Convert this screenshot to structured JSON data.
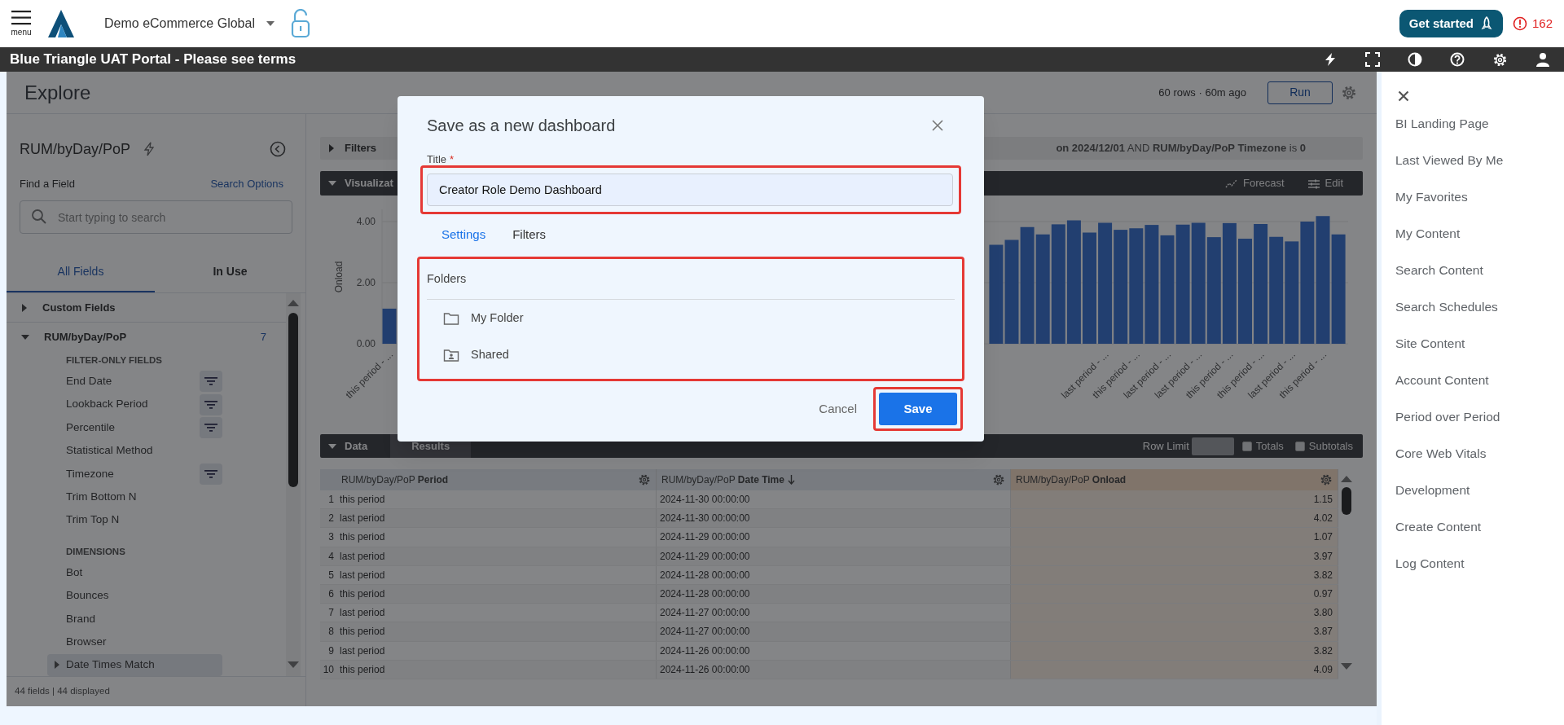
{
  "header": {
    "menu_label": "menu",
    "workspace": "Demo eCommerce Global",
    "get_started": "Get started",
    "alert_count": "162"
  },
  "banner": {
    "title": "Blue Triangle UAT Portal - Please see terms"
  },
  "explore": {
    "title": "Explore",
    "run_info": "60 rows · 60m ago",
    "run_button": "Run"
  },
  "field_panel": {
    "title": "RUM/byDay/PoP",
    "find_label": "Find a Field",
    "search_options": "Search Options",
    "search_placeholder": "Start typing to search",
    "tabs": [
      {
        "label": "All Fields",
        "selected": true
      },
      {
        "label": "In Use",
        "selected": false
      }
    ],
    "tree": [
      {
        "label": "Custom Fields",
        "expanded": false
      },
      {
        "label": "RUM/byDay/PoP",
        "expanded": true,
        "count": "7",
        "groups": [
          {
            "heading": "FILTER-ONLY FIELDS",
            "fields": [
              {
                "label": "End Date",
                "kind": "field",
                "filter": true,
                "hovered": false
              },
              {
                "label": "Lookback Period",
                "kind": "field",
                "filter": true,
                "hovered": false
              },
              {
                "label": "Percentile",
                "kind": "field",
                "filter": true,
                "hovered": false
              },
              {
                "label": "Statistical Method",
                "kind": "field",
                "filter": false,
                "hovered": false
              },
              {
                "label": "Timezone",
                "kind": "field",
                "filter": true,
                "hovered": false
              },
              {
                "label": "Trim Bottom N",
                "kind": "field",
                "filter": false,
                "hovered": false
              },
              {
                "label": "Trim Top N",
                "kind": "field",
                "filter": false,
                "hovered": false
              }
            ]
          },
          {
            "heading": "DIMENSIONS",
            "fields": [
              {
                "label": "Bot",
                "kind": "field",
                "filter": false,
                "hovered": false
              },
              {
                "label": "Bounces",
                "kind": "field",
                "filter": false,
                "hovered": false
              },
              {
                "label": "Brand",
                "kind": "field",
                "filter": false,
                "hovered": false
              },
              {
                "label": "Browser",
                "kind": "field",
                "filter": false,
                "hovered": false
              },
              {
                "label": "Date Times Match",
                "kind": "group",
                "filter": false,
                "hovered": true
              }
            ]
          }
        ]
      }
    ],
    "footer": "44 fields | 44 displayed"
  },
  "filters": {
    "label": "Filters",
    "expanded": false,
    "summary": "**on 2024/12/01** AND **RUM/byDay/PoP Timezone** is **0**"
  },
  "visualization": {
    "label": "Visualizat",
    "expanded": true,
    "actions": [
      {
        "label": "Forecast",
        "kind": "forecast"
      },
      {
        "label": "Edit",
        "kind": "edit"
      }
    ],
    "chart_data": {
      "type": "bar",
      "ylabel": "Onload",
      "ylim": [
        0,
        4.4
      ],
      "yticks": [
        {
          "value": 0,
          "label": "0.00"
        },
        {
          "value": 2,
          "label": "2.00"
        },
        {
          "value": 4,
          "label": "4.00"
        }
      ],
      "categories": [
        "this period - ...",
        null,
        null,
        null,
        null,
        null,
        null,
        null,
        null,
        null,
        null,
        null,
        null,
        null,
        null,
        null,
        null,
        null,
        null,
        null,
        null,
        null,
        null,
        null,
        null,
        null,
        null,
        null,
        null,
        null,
        null,
        null,
        null,
        null,
        null,
        null,
        null,
        null,
        null,
        null,
        null,
        null,
        null,
        null,
        null,
        null,
        "last period - ...",
        null,
        "this period - ...",
        null,
        "last period - ...",
        null,
        "last period - ...",
        null,
        "this period - ...",
        null,
        "this period - ...",
        null,
        "last period - ...",
        null,
        "this period - ...",
        null
      ],
      "values": [
        1.15,
        null,
        null,
        null,
        null,
        null,
        null,
        null,
        null,
        null,
        null,
        null,
        null,
        null,
        null,
        null,
        null,
        null,
        null,
        null,
        null,
        null,
        null,
        null,
        null,
        null,
        null,
        null,
        null,
        null,
        null,
        null,
        null,
        null,
        null,
        null,
        null,
        null,
        null,
        3.24,
        3.4,
        3.82,
        3.58,
        3.91,
        4.04,
        3.64,
        3.96,
        3.73,
        3.78,
        3.89,
        3.55,
        3.9,
        3.96,
        3.49,
        3.95,
        3.44,
        3.92,
        3.5,
        3.35,
        4.0,
        4.18,
        3.58
      ]
    }
  },
  "data": {
    "label": "Data",
    "expanded": true,
    "tabs": [
      {
        "label": "Results",
        "selected": true
      }
    ],
    "row_limit_label": "Row Limit",
    "options": [
      {
        "label": "Totals",
        "checked": false
      },
      {
        "label": "Subtotals",
        "checked": false
      }
    ],
    "table": {
      "columns": [
        {
          "label": "RUM/byDay/PoP **Period**",
          "kind": "dimension",
          "sorted_desc": false
        },
        {
          "label": "RUM/byDay/PoP **Date Time**",
          "kind": "dimension",
          "sorted_desc": true
        },
        {
          "label": "RUM/byDay/PoP **Onload**",
          "kind": "measure",
          "sorted_desc": false
        }
      ],
      "rows": [
        {
          "num": "1",
          "cells": [
            "this period",
            "2024-11-30 00:00:00",
            "1.15"
          ]
        },
        {
          "num": "2",
          "cells": [
            "last period",
            "2024-11-30 00:00:00",
            "4.02"
          ]
        },
        {
          "num": "3",
          "cells": [
            "this period",
            "2024-11-29 00:00:00",
            "1.07"
          ]
        },
        {
          "num": "4",
          "cells": [
            "last period",
            "2024-11-29 00:00:00",
            "3.97"
          ]
        },
        {
          "num": "5",
          "cells": [
            "last period",
            "2024-11-28 00:00:00",
            "3.82"
          ]
        },
        {
          "num": "6",
          "cells": [
            "this period",
            "2024-11-28 00:00:00",
            "0.97"
          ]
        },
        {
          "num": "7",
          "cells": [
            "last period",
            "2024-11-27 00:00:00",
            "3.80"
          ]
        },
        {
          "num": "8",
          "cells": [
            "this period",
            "2024-11-27 00:00:00",
            "3.87"
          ]
        },
        {
          "num": "9",
          "cells": [
            "last period",
            "2024-11-26 00:00:00",
            "3.82"
          ]
        },
        {
          "num": "10",
          "cells": [
            "this period",
            "2024-11-26 00:00:00",
            "4.09"
          ]
        }
      ]
    }
  },
  "modal": {
    "title": "Save as a new dashboard",
    "title_label": "Title",
    "required_mark": "*",
    "title_value": "Creator Role Demo Dashboard",
    "tabs": [
      {
        "label": "Settings",
        "selected": true
      },
      {
        "label": "Filters",
        "selected": false
      }
    ],
    "folders_heading": "Folders",
    "folders": [
      {
        "label": "My Folder",
        "kind": "personal"
      },
      {
        "label": "Shared",
        "kind": "shared"
      }
    ],
    "cancel": "Cancel",
    "save": "Save"
  },
  "sidebar": {
    "items": [
      "BI Landing Page",
      "Last Viewed By Me",
      "My Favorites",
      "My Content",
      "Search Content",
      "Search Schedules",
      "Site Content",
      "Account Content",
      "Period over Period",
      "Core Web Vitals",
      "Development",
      "Create Content",
      "Log Content"
    ]
  }
}
